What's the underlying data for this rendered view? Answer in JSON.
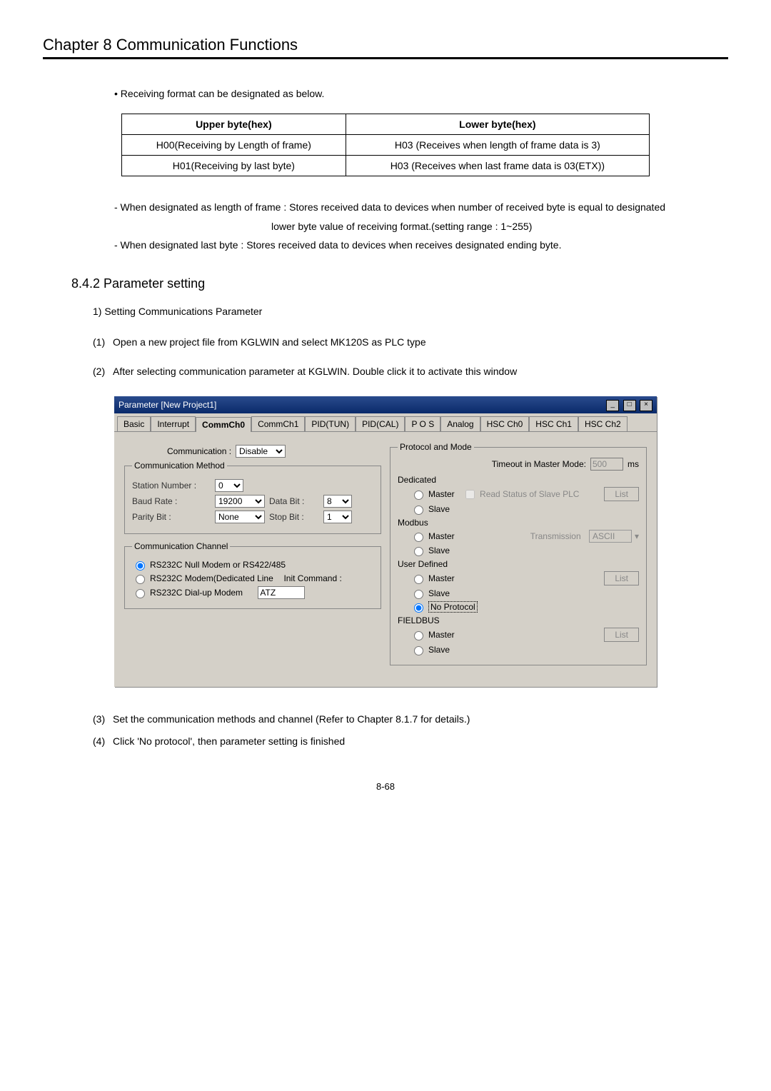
{
  "header": {
    "title": "Chapter 8   Communication Functions"
  },
  "bullet": "• Receiving format can be designated as below.",
  "table": {
    "h1": "Upper byte(hex)",
    "h2": "Lower byte(hex)",
    "r1c1": "H00(Receiving by Length of frame)",
    "r1c2": "H03 (Receives when length of frame data is 3)",
    "r2c1": "H01(Receiving by last byte)",
    "r2c2": "H03 (Receives when last frame data is 03(ETX))"
  },
  "notes": {
    "n1a": "- When designated as length of frame : Stores received data to devices when number of received byte is equal to designated",
    "n1b": "lower byte value of receiving format.(setting range : 1~255)",
    "n2": "- When designated last byte : Stores received data to devices when receives designated ending byte."
  },
  "section": "8.4.2 Parameter setting",
  "sub1": "1) Setting Communications Parameter",
  "steps": {
    "s1": "Open a new project file from KGLWIN and select MK120S as PLC type",
    "s2": "After selecting communication parameter at KGLWIN. Double click it to activate this window",
    "s3": "Set the communication methods and channel (Refer to Chapter 8.1.7 for details.)",
    "s4": "Click 'No protocol', then parameter setting is finished"
  },
  "dialog": {
    "title": "Parameter [New Project1]",
    "tabs": [
      "Basic",
      "Interrupt",
      "CommCh0",
      "CommCh1",
      "PID(TUN)",
      "PID(CAL)",
      "P O S",
      "Analog",
      "HSC Ch0",
      "HSC Ch1",
      "HSC Ch2"
    ],
    "comm_label": "Communication :",
    "comm_value": "Disable",
    "method_legend": "Communication Method",
    "station_label": "Station Number :",
    "station_value": "0",
    "baud_label": "Baud Rate :",
    "baud_value": "19200",
    "databit_label": "Data Bit :",
    "databit_value": "8",
    "parity_label": "Parity Bit :",
    "parity_value": "None",
    "stopbit_label": "Stop Bit :",
    "stopbit_value": "1",
    "channel_legend": "Communication Channel",
    "chan1": "RS232C Null Modem or RS422/485",
    "chan2": "RS232C Modem(Dedicated Line",
    "initcmd_label": "Init Command :",
    "initcmd_value": "ATZ",
    "chan3": "RS232C Dial-up Modem",
    "pm_legend": "Protocol and Mode",
    "timeout_label": "Timeout in Master Mode:",
    "timeout_value": "500",
    "timeout_unit": "ms",
    "dedicated": "Dedicated",
    "master": "Master",
    "readstatus": "Read Status of Slave PLC",
    "slave": "Slave",
    "list": "List",
    "modbus": "Modbus",
    "transmission": "Transmission",
    "ascii": "ASCII",
    "userdef": "User Defined",
    "noprotocol": "No Protocol",
    "fieldbus": "FIELDBUS"
  },
  "pagenum": "8-68"
}
